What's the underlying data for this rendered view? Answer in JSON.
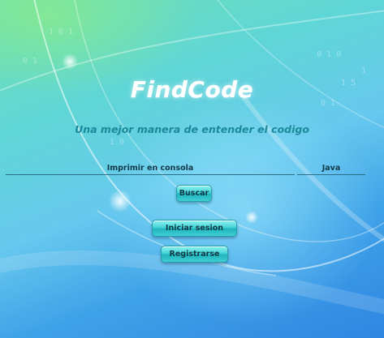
{
  "app": {
    "title": "FindCode",
    "subtitle": "Una mejor manera de entender el codigo"
  },
  "search": {
    "value": "Imprimir en consola",
    "language": "Java"
  },
  "buttons": {
    "search_label": "Buscar",
    "login_label": "Iniciar sesion",
    "register_label": "Registrarse"
  }
}
